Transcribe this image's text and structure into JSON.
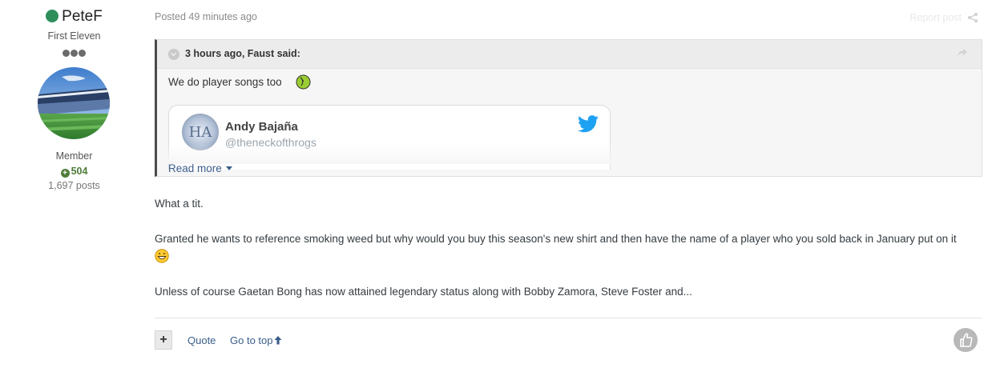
{
  "author": {
    "name": "PeteF",
    "online_color": "#2e8f5a",
    "rank_title": "First Eleven",
    "group": "Member",
    "reputation": "504",
    "post_count": "1,697 posts"
  },
  "post": {
    "posted_prefix": "Posted",
    "posted_time": "49 minutes ago",
    "report_label": "Report post",
    "share_icon": "share-icon"
  },
  "quote": {
    "citation": "3 hours ago, Faust said:",
    "text": "We do player songs too",
    "tweet": {
      "name": "Andy Bajaña",
      "handle": "@theneckofthrogs",
      "avatar_letters": "HA"
    },
    "read_more": "Read more"
  },
  "body": {
    "p1": "What a tit.",
    "p2": "Granted he wants to reference smoking weed but why would you buy this season's new shirt and then have the name of a player who you sold back in January put on it",
    "p3": "Unless of course Gaetan Bong has now attained legendary status along with Bobby Zamora, Steve Foster and..."
  },
  "footer": {
    "multiquote_label": "+",
    "quote_label": "Quote",
    "goto_top_label": "Go to top"
  },
  "colors": {
    "link": "#3b5e8a",
    "reputation": "#4f7c39"
  }
}
